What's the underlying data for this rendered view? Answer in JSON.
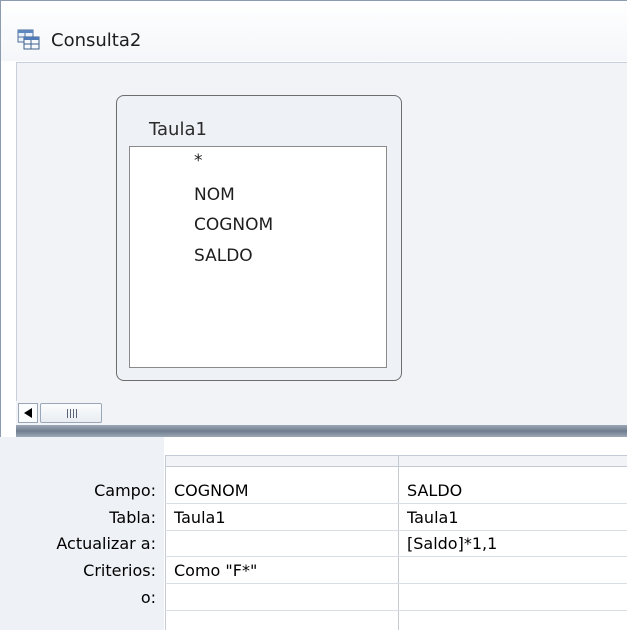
{
  "window": {
    "title": "Consulta2",
    "icon": "query-icon"
  },
  "table_box": {
    "name": "Taula1",
    "fields": [
      "*",
      "NOM",
      "COGNOM",
      "SALDO"
    ]
  },
  "scrollbar": {
    "left_arrow": "scroll-left-arrow",
    "thumb": "scroll-thumb"
  },
  "grid": {
    "row_labels": {
      "campo": "Campo:",
      "tabla": "Tabla:",
      "actualizar": "Actualizar a:",
      "criterios": "Criterios:",
      "o": "o:"
    },
    "columns": [
      {
        "campo": "COGNOM",
        "tabla": "Taula1",
        "actualizar": "",
        "criterios": "Como \"F*\"",
        "o": ""
      },
      {
        "campo": "SALDO",
        "tabla": "Taula1",
        "actualizar": "[Saldo]*1,1",
        "criterios": "",
        "o": ""
      }
    ]
  },
  "colors": {
    "panel_bg": "#f1f3f6",
    "splitter": "#6f7d90"
  }
}
